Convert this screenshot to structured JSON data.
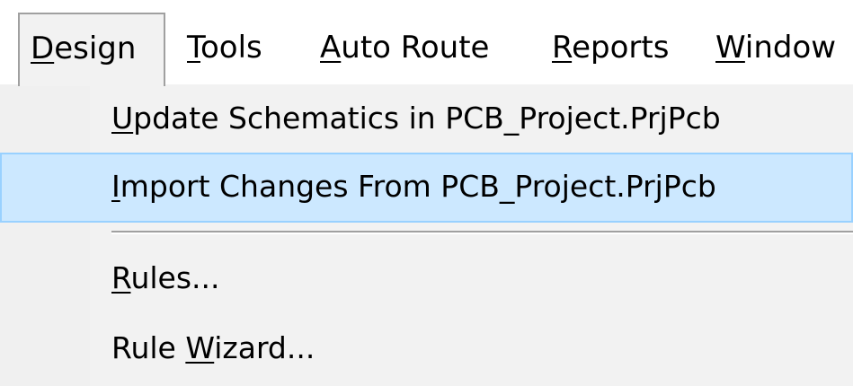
{
  "menubar": {
    "items": [
      {
        "prefix": "",
        "accel": "D",
        "suffix": "esign",
        "open": true
      },
      {
        "prefix": "",
        "accel": "T",
        "suffix": "ools"
      },
      {
        "prefix": "",
        "accel": "A",
        "suffix": "uto Route"
      },
      {
        "prefix": "",
        "accel": "R",
        "suffix": "eports"
      },
      {
        "prefix": "",
        "accel": "W",
        "suffix": "indow"
      }
    ]
  },
  "dropdown": {
    "items": [
      {
        "prefix": "",
        "accel": "U",
        "suffix": "pdate Schematics in PCB_Project.PrjPcb",
        "highlighted": false
      },
      {
        "prefix": "",
        "accel": "I",
        "suffix": "mport Changes From PCB_Project.PrjPcb",
        "highlighted": true
      },
      {
        "prefix": "",
        "accel": "R",
        "suffix": "ules...",
        "highlighted": false
      },
      {
        "prefix": "Rule ",
        "accel": "W",
        "suffix": "izard...",
        "highlighted": false
      }
    ]
  },
  "colors": {
    "highlight_fill": "#cce8ff",
    "highlight_border": "#99d1ff",
    "menu_background": "#f2f2f2"
  }
}
